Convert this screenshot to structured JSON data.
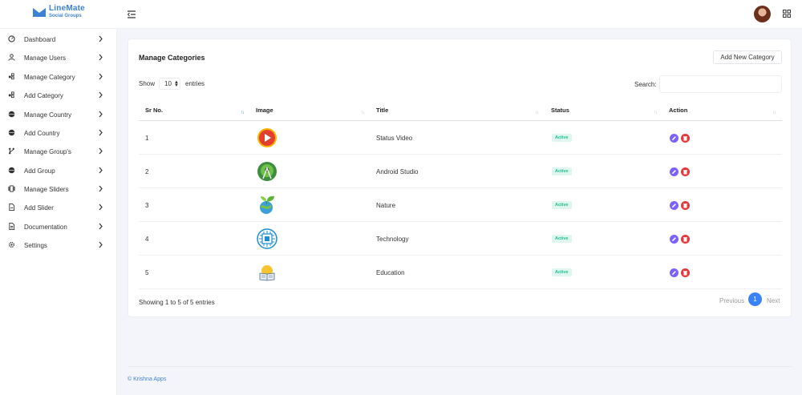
{
  "brand": {
    "name": "LineMate",
    "tagline": "Social Groups"
  },
  "sidebar": {
    "items": [
      {
        "label": "Dashboard",
        "icon": "dashboard-icon"
      },
      {
        "label": "Manage Users",
        "icon": "user-icon"
      },
      {
        "label": "Manage Category",
        "icon": "category-icon"
      },
      {
        "label": "Add Category",
        "icon": "category-icon"
      },
      {
        "label": "Manage Country",
        "icon": "globe-icon"
      },
      {
        "label": "Add Country",
        "icon": "globe-icon"
      },
      {
        "label": "Manage Group's",
        "icon": "group-icon"
      },
      {
        "label": "Add Group",
        "icon": "globe-icon"
      },
      {
        "label": "Manage Sliders",
        "icon": "slider-icon"
      },
      {
        "label": "Add Slider",
        "icon": "file-icon"
      },
      {
        "label": "Documentation",
        "icon": "document-icon"
      },
      {
        "label": "Settings",
        "icon": "gear-icon"
      }
    ]
  },
  "page": {
    "title": "Manage Categories",
    "add_button": "Add New Category",
    "show_label": "Show",
    "entries_value": "10",
    "entries_label": "entries",
    "search_label": "Search:",
    "search_value": ""
  },
  "table": {
    "headers": [
      "Sr No.",
      "Image",
      "Title",
      "Status",
      "Action"
    ],
    "rows": [
      {
        "sr": "1",
        "title": "Status Video",
        "status": "Active",
        "image": "play-icon"
      },
      {
        "sr": "2",
        "title": "Android Studio",
        "status": "Active",
        "image": "android-studio-icon"
      },
      {
        "sr": "3",
        "title": "Nature",
        "status": "Active",
        "image": "nature-icon"
      },
      {
        "sr": "4",
        "title": "Technology",
        "status": "Active",
        "image": "chip-icon"
      },
      {
        "sr": "5",
        "title": "Education",
        "status": "Active",
        "image": "book-icon"
      }
    ]
  },
  "pagination": {
    "info": "Showing 1 to 5 of 5 entries",
    "previous": "Previous",
    "current": "1",
    "next": "Next"
  },
  "footer": {
    "text": "© Krishna Apps"
  },
  "colors": {
    "accent": "#3b82f6",
    "active_badge": "#1fbf8f",
    "edit": "#7b61ff",
    "delete": "#e5383b"
  }
}
